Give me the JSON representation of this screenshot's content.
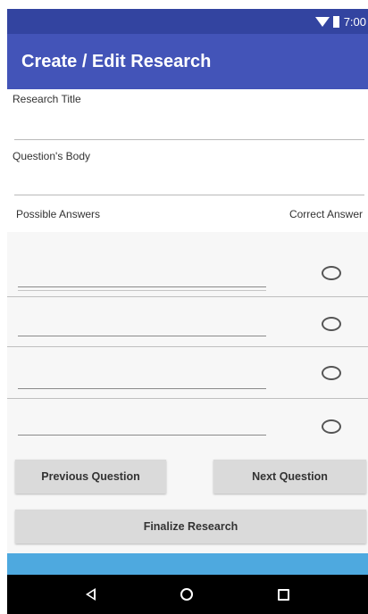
{
  "status_bar": {
    "time": "7:00"
  },
  "app_bar": {
    "title": "Create / Edit Research"
  },
  "form": {
    "research_title_label": "Research Title",
    "question_body_label": "Question's Body",
    "possible_answers_label": "Possible Answers",
    "correct_answer_label": "Correct Answer",
    "answers": [
      {
        "value": ""
      },
      {
        "value": ""
      },
      {
        "value": ""
      },
      {
        "value": ""
      }
    ]
  },
  "buttons": {
    "previous": "Previous Question",
    "next": "Next Question",
    "finalize": "Finalize Research"
  },
  "colors": {
    "status_bar": "#3344a0",
    "app_bar": "#4354b8",
    "accent_strip": "#4ea9df",
    "button": "#dadada"
  },
  "icons": [
    "wifi-icon",
    "battery-icon",
    "back-icon",
    "home-icon",
    "recents-icon",
    "radio-unchecked-icon"
  ]
}
